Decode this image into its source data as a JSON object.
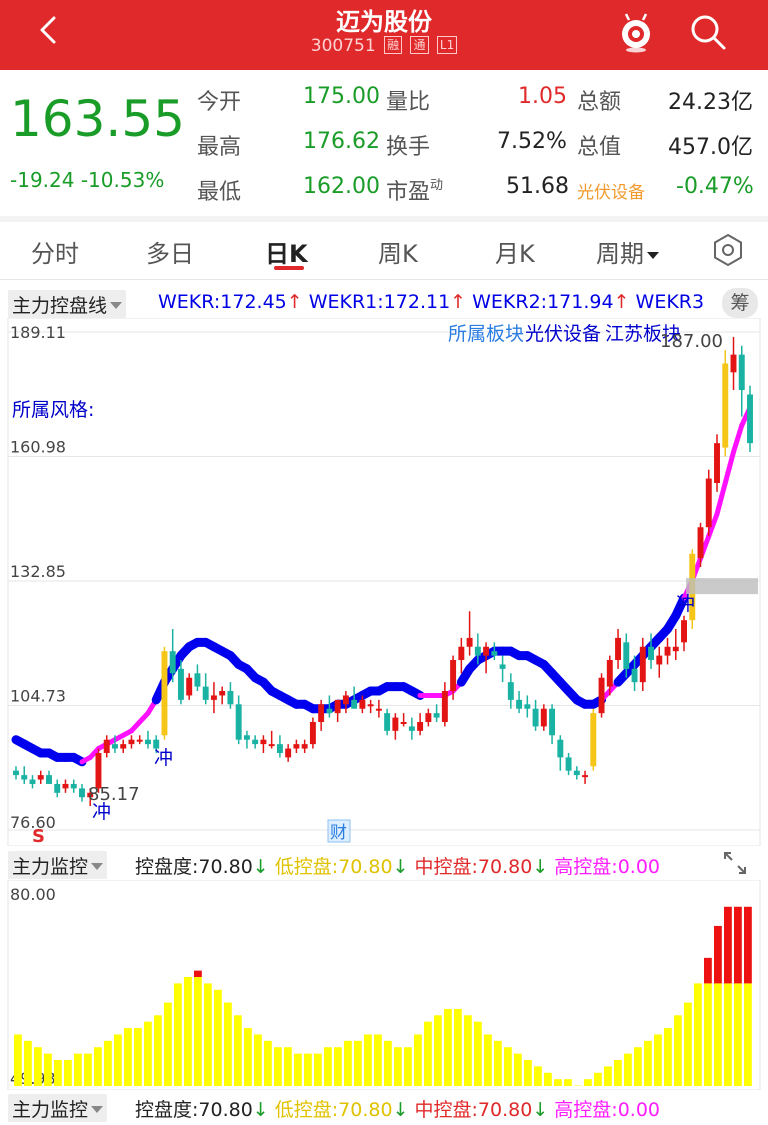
{
  "header": {
    "title": "迈为股份",
    "code": "300751",
    "tags": [
      "融",
      "通",
      "L1"
    ]
  },
  "quote": {
    "price": "163.55",
    "change": "-19.24",
    "change_pct": "-10.53%",
    "stats": [
      {
        "label": "今开",
        "value": "175.00",
        "color": "green"
      },
      {
        "label": "量比",
        "value": "1.05",
        "color": "red"
      },
      {
        "label": "总额",
        "value": "24.23亿",
        "color": "dark"
      },
      {
        "label": "最高",
        "value": "176.62",
        "color": "green"
      },
      {
        "label": "换手",
        "value": "7.52%",
        "color": "dark"
      },
      {
        "label": "总值",
        "value": "457.0亿",
        "color": "dark"
      },
      {
        "label": "最低",
        "value": "162.00",
        "color": "green"
      },
      {
        "label": "市盈",
        "sup": "动",
        "value": "51.68",
        "color": "dark"
      },
      {
        "label": "光伏设备",
        "value": "-0.47%",
        "color": "green"
      }
    ]
  },
  "tabs": [
    "分时",
    "多日",
    "日K",
    "周K",
    "月K",
    "周期"
  ],
  "active_tab": "日K",
  "main_indicator": {
    "name": "主力控盘线",
    "values": [
      {
        "label": "WEKR:172.45",
        "arrow": "↑"
      },
      {
        "label": "WEKR1:172.11",
        "arrow": "↑"
      },
      {
        "label": "WEKR2:171.94",
        "arrow": "↑"
      },
      {
        "label": "WEKR3",
        "arrow": ""
      }
    ],
    "button": "筹"
  },
  "chart_annotations": {
    "sector_label": "所属板块",
    "sector_pv": "光伏设备",
    "sector_js": "江苏板块",
    "style_label": "所属风格:",
    "high_label": "187.00",
    "low_label": "85.17",
    "chong": "冲",
    "cai": "财",
    "s_mark": "S"
  },
  "chart_data": [
    {
      "type": "candlestick",
      "y_ticks": [
        "189.11",
        "160.98",
        "132.85",
        "104.73",
        "76.60"
      ],
      "ylim": [
        76.6,
        189.11
      ],
      "colors": {
        "up": "#e31414",
        "down": "#1ab3a3",
        "bull_warn": "#f5c518",
        "ma_down": "#0000ee",
        "ma_up": "#ff10ff"
      },
      "candles": [
        [
          90,
          91,
          88,
          89
        ],
        [
          89,
          91,
          87,
          88
        ],
        [
          88,
          89,
          86,
          87
        ],
        [
          88,
          90,
          87,
          89
        ],
        [
          89,
          90,
          87,
          87
        ],
        [
          87,
          88,
          84,
          85
        ],
        [
          86,
          88,
          85,
          87
        ],
        [
          87,
          88,
          85,
          86
        ],
        [
          86,
          87,
          83,
          84
        ],
        [
          84,
          86,
          82,
          85
        ],
        [
          86,
          95,
          85,
          94
        ],
        [
          94,
          98,
          93,
          97
        ],
        [
          96,
          98,
          94,
          95
        ],
        [
          95,
          97,
          94,
          96
        ],
        [
          96,
          98,
          95,
          97
        ],
        [
          97,
          98,
          96,
          97
        ],
        [
          97,
          99,
          95,
          96
        ],
        [
          97,
          98,
          94,
          95
        ],
        [
          98,
          118,
          97,
          117
        ],
        [
          117,
          122,
          110,
          112
        ],
        [
          113,
          115,
          105,
          106
        ],
        [
          107,
          112,
          106,
          111
        ],
        [
          112,
          114,
          108,
          109
        ],
        [
          109,
          112,
          105,
          106
        ],
        [
          106,
          110,
          103,
          107
        ],
        [
          107,
          109,
          105,
          108
        ],
        [
          108,
          110,
          104,
          105
        ],
        [
          105,
          107,
          96,
          97
        ],
        [
          98,
          99,
          95,
          97
        ],
        [
          97,
          98,
          95,
          96
        ],
        [
          96,
          98,
          94,
          97
        ],
        [
          96,
          99,
          95,
          96
        ],
        [
          96,
          98,
          93,
          94
        ],
        [
          93,
          96,
          92,
          95
        ],
        [
          95,
          97,
          94,
          96
        ],
        [
          95,
          97,
          94,
          96
        ],
        [
          96,
          102,
          95,
          101
        ],
        [
          101,
          106,
          99,
          105
        ],
        [
          104,
          107,
          102,
          103
        ],
        [
          103,
          106,
          101,
          106
        ],
        [
          105,
          108,
          103,
          107
        ],
        [
          106,
          109,
          104,
          104
        ],
        [
          104,
          107,
          103,
          106
        ],
        [
          105,
          106,
          103,
          105
        ],
        [
          104,
          106,
          102,
          104
        ],
        [
          103,
          104,
          98,
          99
        ],
        [
          99,
          103,
          97,
          102
        ],
        [
          101,
          103,
          100,
          101
        ],
        [
          100,
          102,
          97,
          99
        ],
        [
          99,
          103,
          98,
          101
        ],
        [
          101,
          104,
          100,
          103
        ],
        [
          103,
          105,
          101,
          102
        ],
        [
          101,
          110,
          100,
          108
        ],
        [
          108,
          116,
          106,
          115
        ],
        [
          115,
          120,
          112,
          118
        ],
        [
          118,
          126,
          116,
          120
        ],
        [
          118,
          121,
          114,
          116
        ],
        [
          116,
          119,
          112,
          118
        ],
        [
          117,
          119,
          115,
          116
        ],
        [
          114,
          116,
          110,
          113
        ],
        [
          110,
          112,
          104,
          106
        ],
        [
          106,
          108,
          103,
          104
        ],
        [
          105,
          107,
          102,
          104
        ],
        [
          104,
          106,
          99,
          100
        ],
        [
          100,
          105,
          99,
          104
        ],
        [
          104,
          105,
          96,
          98
        ],
        [
          97,
          98,
          90,
          93
        ],
        [
          93,
          94,
          89,
          90
        ],
        [
          90,
          91,
          88,
          89
        ],
        [
          89,
          90,
          87,
          89
        ],
        [
          91,
          104,
          90,
          103
        ],
        [
          103,
          112,
          102,
          111
        ],
        [
          109,
          116,
          107,
          115
        ],
        [
          115,
          122,
          113,
          120
        ],
        [
          119,
          121,
          111,
          113
        ],
        [
          113,
          116,
          108,
          110
        ],
        [
          110,
          120,
          108,
          118
        ],
        [
          118,
          121,
          113,
          115
        ],
        [
          114,
          118,
          111,
          116
        ],
        [
          116,
          120,
          114,
          118
        ],
        [
          117,
          122,
          115,
          118
        ],
        [
          119,
          125,
          117,
          124
        ],
        [
          124,
          140,
          122,
          139
        ],
        [
          138,
          146,
          136,
          145
        ],
        [
          145,
          158,
          143,
          156
        ],
        [
          155,
          166,
          153,
          164
        ],
        [
          163,
          185,
          161,
          182
        ],
        [
          180,
          188,
          176,
          184
        ],
        [
          184,
          186,
          170,
          176
        ],
        [
          175,
          177,
          162,
          164
        ]
      ],
      "warn_candles": [
        18,
        70,
        82,
        86
      ],
      "ma": [
        [
          97,
          93,
          true
        ],
        [
          96,
          92,
          true
        ],
        [
          95,
          91,
          true
        ],
        [
          94,
          90,
          true
        ],
        [
          94,
          90,
          true
        ],
        [
          93,
          90,
          true
        ],
        [
          93,
          90,
          true
        ],
        [
          93,
          90,
          true
        ],
        [
          92,
          90,
          true
        ],
        [
          93,
          91,
          false
        ],
        [
          95,
          92,
          false
        ],
        [
          96,
          93,
          false
        ],
        [
          97,
          94,
          false
        ],
        [
          98,
          95,
          false
        ],
        [
          99,
          97,
          false
        ],
        [
          101,
          99,
          false
        ],
        [
          103,
          102,
          false
        ],
        [
          106,
          105,
          false
        ],
        [
          110,
          108,
          true
        ],
        [
          113,
          111,
          true
        ],
        [
          116,
          114,
          true
        ],
        [
          118,
          116,
          true
        ],
        [
          119,
          117,
          true
        ],
        [
          119,
          117,
          true
        ],
        [
          118,
          116,
          true
        ],
        [
          117,
          115,
          true
        ],
        [
          116,
          114,
          true
        ],
        [
          114,
          112,
          true
        ],
        [
          113,
          111,
          true
        ],
        [
          111,
          109,
          true
        ],
        [
          110,
          108,
          true
        ],
        [
          108,
          107,
          true
        ],
        [
          107,
          106,
          true
        ],
        [
          106,
          105,
          true
        ],
        [
          105,
          104,
          true
        ],
        [
          105,
          104,
          true
        ],
        [
          104,
          104,
          true
        ],
        [
          104,
          104,
          true
        ],
        [
          104,
          104,
          true
        ],
        [
          105,
          105,
          true
        ],
        [
          105,
          105,
          true
        ],
        [
          106,
          106,
          true
        ],
        [
          107,
          107,
          true
        ],
        [
          108,
          108,
          true
        ],
        [
          108,
          108,
          true
        ],
        [
          109,
          109,
          true
        ],
        [
          109,
          109,
          true
        ],
        [
          109,
          109,
          true
        ],
        [
          108,
          108,
          true
        ],
        [
          107,
          107,
          true
        ],
        [
          107,
          107,
          false
        ],
        [
          107,
          107,
          false
        ],
        [
          107,
          107,
          false
        ],
        [
          108,
          108,
          false
        ],
        [
          110,
          110,
          false
        ],
        [
          113,
          113,
          true
        ],
        [
          115,
          115,
          true
        ],
        [
          116,
          116,
          true
        ],
        [
          117,
          117,
          true
        ],
        [
          117,
          117,
          true
        ],
        [
          117,
          117,
          true
        ],
        [
          116,
          116,
          true
        ],
        [
          116,
          116,
          true
        ],
        [
          115,
          115,
          true
        ],
        [
          114,
          114,
          true
        ],
        [
          112,
          112,
          true
        ],
        [
          110,
          110,
          true
        ],
        [
          108,
          108,
          true
        ],
        [
          106,
          106,
          true
        ],
        [
          105,
          105,
          true
        ],
        [
          105,
          105,
          true
        ],
        [
          106,
          106,
          true
        ],
        [
          108,
          108,
          false
        ],
        [
          110,
          110,
          false
        ],
        [
          112,
          112,
          true
        ],
        [
          114,
          114,
          true
        ],
        [
          116,
          116,
          true
        ],
        [
          118,
          118,
          true
        ],
        [
          120,
          120,
          true
        ],
        [
          122,
          122,
          true
        ],
        [
          125,
          125,
          true
        ],
        [
          129,
          129,
          true
        ],
        [
          133,
          133,
          false
        ],
        [
          138,
          138,
          false
        ],
        [
          143,
          143,
          false
        ],
        [
          148,
          148,
          false
        ],
        [
          155,
          155,
          false
        ],
        [
          162,
          162,
          false
        ],
        [
          168,
          168,
          false
        ],
        [
          172,
          172,
          false
        ]
      ]
    },
    {
      "type": "bar",
      "y_ticks": [
        "80.00",
        "49.93"
      ],
      "ylim": [
        49.93,
        80.0
      ],
      "yellow": [
        58,
        57,
        56,
        55,
        54,
        54,
        55,
        55,
        56,
        57,
        58,
        59,
        59,
        60,
        61,
        63,
        66,
        67,
        67,
        66,
        65,
        63,
        61,
        59,
        58,
        57,
        56,
        56,
        55,
        55,
        55,
        56,
        56,
        57,
        57,
        58,
        58,
        57,
        56,
        56,
        58,
        60,
        61,
        62,
        62,
        61,
        60,
        58,
        57,
        56,
        55,
        54,
        53,
        52,
        51,
        51,
        50,
        51,
        52,
        53,
        54,
        55,
        56,
        57,
        58,
        59,
        61,
        63,
        66,
        66,
        66,
        66,
        66,
        66
      ],
      "red": [
        0,
        0,
        0,
        0,
        0,
        0,
        0,
        0,
        0,
        0,
        0,
        0,
        0,
        0,
        0,
        0,
        0,
        0,
        1,
        0,
        0,
        0,
        0,
        0,
        0,
        0,
        0,
        0,
        0,
        0,
        0,
        0,
        0,
        0,
        0,
        0,
        0,
        0,
        0,
        0,
        0,
        0,
        0,
        0,
        0,
        0,
        0,
        0,
        0,
        0,
        0,
        0,
        0,
        0,
        0,
        0,
        0,
        0,
        0,
        0,
        0,
        0,
        0,
        0,
        0,
        0,
        0,
        0,
        0,
        4,
        9,
        12,
        12,
        12
      ]
    }
  ],
  "sub_indicator": {
    "name": "主力监控",
    "items": [
      {
        "label": "控盘度:70.80",
        "arrow": "↓",
        "color": "#222"
      },
      {
        "label": "低控盘:70.80",
        "arrow": "↓",
        "color": "#e0c200"
      },
      {
        "label": "中控盘:70.80",
        "arrow": "↓",
        "color": "#e0292a"
      },
      {
        "label": "高控盘:0.00",
        "arrow": "",
        "color": "#ff1dff"
      }
    ]
  }
}
